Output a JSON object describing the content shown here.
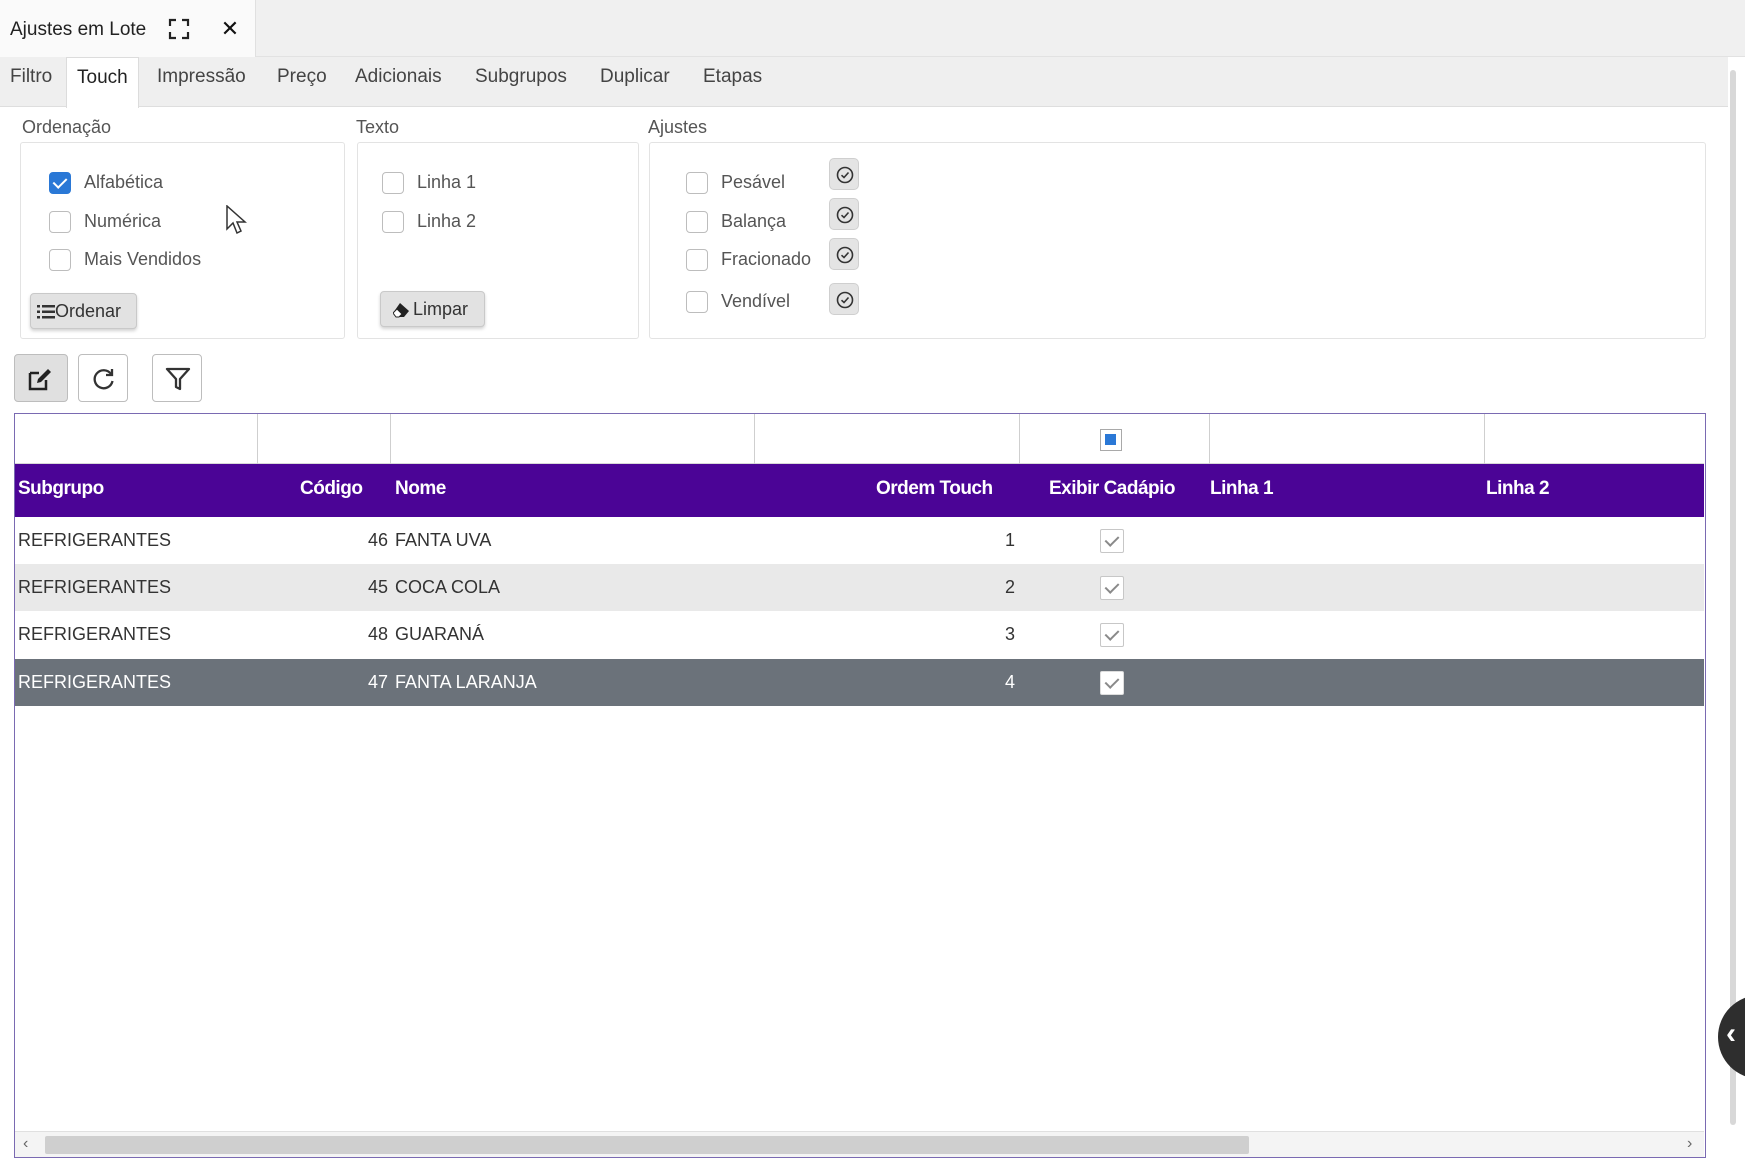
{
  "window": {
    "title": "Ajustes em Lote",
    "maximize_icon": "expand-icon",
    "close_label": "✕"
  },
  "tabs": [
    "Filtro",
    "Touch",
    "Impressão",
    "Preço",
    "Adicionais",
    "Subgrupos",
    "Duplicar",
    "Etapas"
  ],
  "active_tab": "Touch",
  "ordenacao": {
    "title": "Ordenação",
    "options": [
      {
        "label": "Alfabética",
        "checked": true
      },
      {
        "label": "Numérica",
        "checked": false
      },
      {
        "label": "Mais Vendidos",
        "checked": false
      }
    ],
    "button_label": "Ordenar"
  },
  "texto": {
    "title": "Texto",
    "options": [
      {
        "label": "Linha 1",
        "checked": false
      },
      {
        "label": "Linha 2",
        "checked": false
      }
    ],
    "button_label": "Limpar"
  },
  "ajustes": {
    "title": "Ajustes",
    "options": [
      {
        "label": "Pesável",
        "checked": false
      },
      {
        "label": "Balança",
        "checked": false
      },
      {
        "label": "Fracionado",
        "checked": false
      },
      {
        "label": "Vendível",
        "checked": false
      }
    ]
  },
  "toolbar": [
    "edit-icon",
    "refresh-icon",
    "filter-icon"
  ],
  "grid": {
    "columns": [
      "Subgrupo",
      "Código",
      "Nome",
      "Ordem Touch",
      "Exibir Cadápio",
      "Linha 1",
      "Linha 2"
    ],
    "rows": [
      {
        "subgrupo": "REFRIGERANTES",
        "codigo": "46",
        "nome": "FANTA UVA",
        "ordem": "1",
        "exibir": true
      },
      {
        "subgrupo": "REFRIGERANTES",
        "codigo": "45",
        "nome": "COCA COLA",
        "ordem": "2",
        "exibir": true
      },
      {
        "subgrupo": "REFRIGERANTES",
        "codigo": "48",
        "nome": "GUARANÁ",
        "ordem": "3",
        "exibir": true
      },
      {
        "subgrupo": "REFRIGERANTES",
        "codigo": "47",
        "nome": "FANTA LARANJA",
        "ordem": "4",
        "exibir": true
      }
    ],
    "selected_row": 3
  },
  "colors": {
    "header_bg": "#4b0496",
    "selected_row_bg": "#6b727a",
    "checkbox_blue": "#2a78d6"
  }
}
